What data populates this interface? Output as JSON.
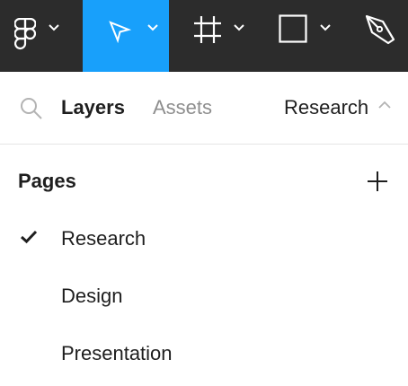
{
  "toolbar": {
    "tools": [
      {
        "icon": "figma-logo-icon",
        "active": false
      },
      {
        "icon": "move-cursor-icon",
        "active": true
      },
      {
        "icon": "frame-icon",
        "active": false
      },
      {
        "icon": "rectangle-icon",
        "active": false
      },
      {
        "icon": "pen-icon",
        "active": false
      }
    ],
    "active_color": "#18a0fb",
    "background": "#2c2c2c"
  },
  "panel": {
    "search_icon": "search-icon",
    "tabs": [
      {
        "label": "Layers",
        "active": true
      },
      {
        "label": "Assets",
        "active": false
      }
    ],
    "current_page": "Research"
  },
  "pages": {
    "title": "Pages",
    "add_icon": "plus-icon",
    "items": [
      {
        "label": "Research",
        "selected": true
      },
      {
        "label": "Design",
        "selected": false
      },
      {
        "label": "Presentation",
        "selected": false
      }
    ]
  }
}
